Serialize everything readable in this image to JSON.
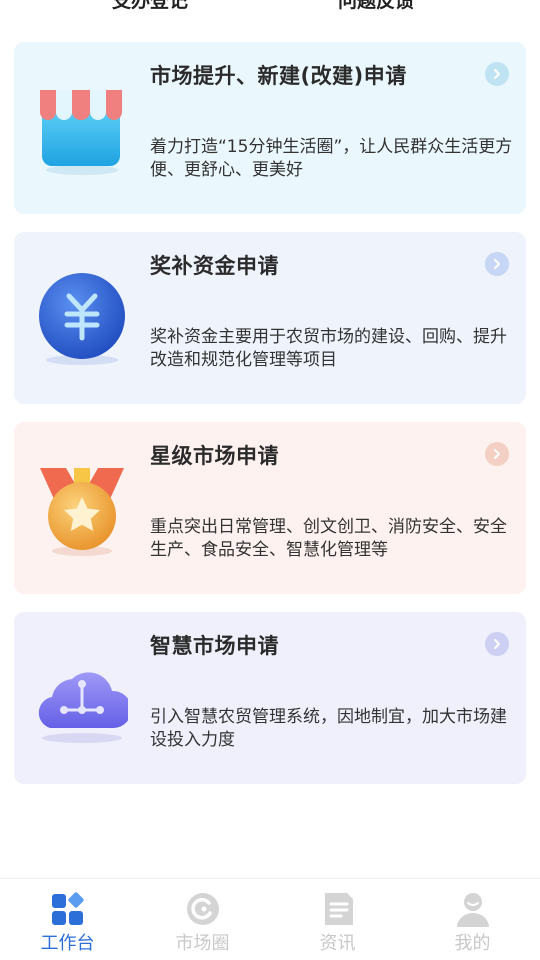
{
  "top_tabs": [
    "支办登记",
    "问题反馈"
  ],
  "cards": [
    {
      "title": "市场提升、新建(改建)申请",
      "description": "着力打造“15分钟生活圈”，让人民群众生活更方便、更舒心、更美好",
      "icon": "storefront-icon",
      "color": "#3fb6ea"
    },
    {
      "title": "奖补资金申请",
      "description": "奖补资金主要用于农贸市场的建设、回购、提升改造和规范化管理等项目",
      "icon": "yuan-coin-icon",
      "color": "#2f62d1"
    },
    {
      "title": "星级市场申请",
      "description": "重点突出日常管理、创文创卫、消防安全、安全生产、食品安全、智慧化管理等",
      "icon": "star-medal-icon",
      "color": "#f0a23a"
    },
    {
      "title": "智慧市场申请",
      "description": "引入智慧农贸管理系统，因地制宜，加大市场建设投入力度",
      "icon": "cloud-network-icon",
      "color": "#7a74ee"
    }
  ],
  "tabbar": {
    "items": [
      {
        "label": "工作台",
        "icon": "workbench-icon",
        "active": true
      },
      {
        "label": "市场圈",
        "icon": "market-circle-icon",
        "active": false
      },
      {
        "label": "资讯",
        "icon": "news-icon",
        "active": false
      },
      {
        "label": "我的",
        "icon": "profile-icon",
        "active": false
      }
    ],
    "active_color": "#2c6fd8",
    "inactive_color": "#c8c8c8"
  }
}
